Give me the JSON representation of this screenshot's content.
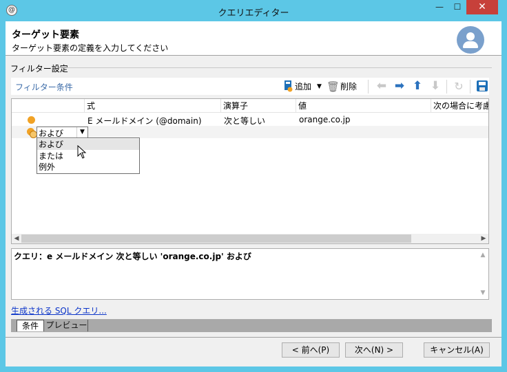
{
  "window": {
    "title": "クエリエディター",
    "min_glyph": "—",
    "max_glyph": "☐",
    "close_glyph": "✕"
  },
  "header": {
    "title": "ターゲット要素",
    "subtitle": "ターゲット要素の定義を入力してください"
  },
  "group": {
    "label": "フィルター設定"
  },
  "toolbar": {
    "filter_label": "フィルター条件",
    "add_label": "追加",
    "delete_label": "削除",
    "icons": [
      "add-icon",
      "trash-icon",
      "arrow-left-icon",
      "arrow-right-icon",
      "arrow-up-icon",
      "arrow-down-icon",
      "refresh-icon",
      "save-icon"
    ]
  },
  "grid": {
    "columns": [
      "式",
      "演算子",
      "値",
      "次の場合に考慮"
    ],
    "rows": [
      {
        "expression": "E メールドメイン (@domain)",
        "operator": "次と等しい",
        "value": "orange.co.jp"
      }
    ],
    "combo_value": "および",
    "dropdown_options": [
      "および",
      "または",
      "例外"
    ],
    "selected_option": "および"
  },
  "query": {
    "text": "クエリ：e メールドメイン 次と等しい 'orange.co.jp' および"
  },
  "sql_link": "生成される SQL クエリ...",
  "tabs": [
    "条件",
    "プレビュー"
  ],
  "footer": {
    "prev": "< 前へ(P)",
    "next": "次へ(N) >",
    "cancel": "キャンセル(A)"
  },
  "colors": {
    "titlebar": "#5cc7e6",
    "close": "#c7403a",
    "accent": "#2c72be",
    "dot": "#f1a225"
  }
}
